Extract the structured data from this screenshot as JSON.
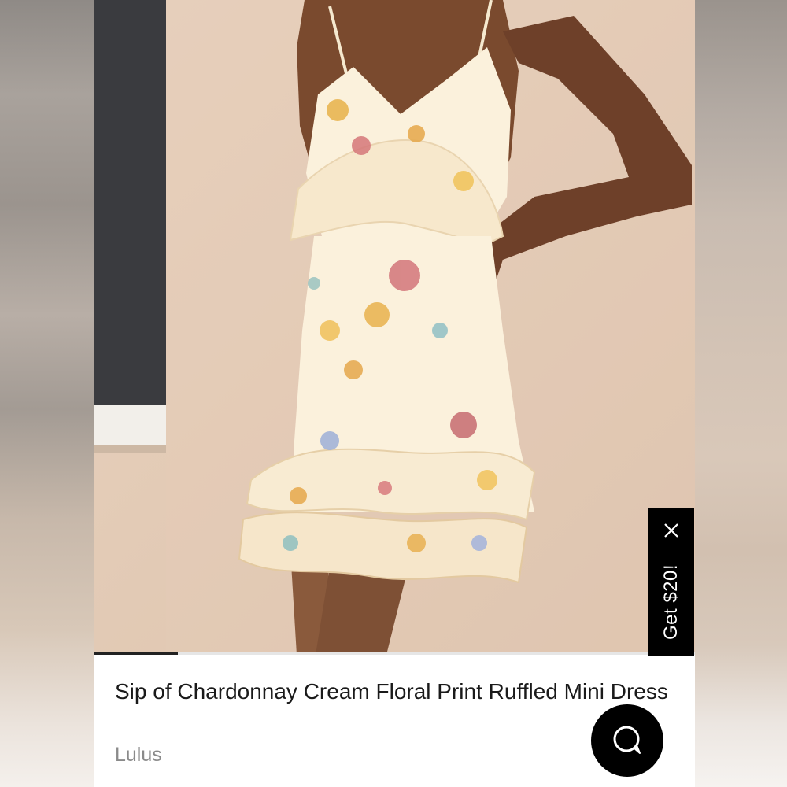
{
  "product": {
    "title": "Sip of Chardonnay Cream Floral Print Ruffled Mini Dress",
    "brand": "Lulus"
  },
  "gallery": {
    "image_icon": "product-photo",
    "progress": 0.14
  },
  "promo": {
    "label": "Get $20!",
    "close_icon": "close-icon"
  },
  "chat": {
    "icon": "chat-bubble-icon"
  },
  "colors": {
    "promo_background": "#000000",
    "chat_background": "#000000",
    "title_text": "#1a1a1a",
    "brand_text": "#8a8a8a",
    "dress_cream": "#fbf1dc",
    "wall_beige": "#e3cbb6"
  }
}
